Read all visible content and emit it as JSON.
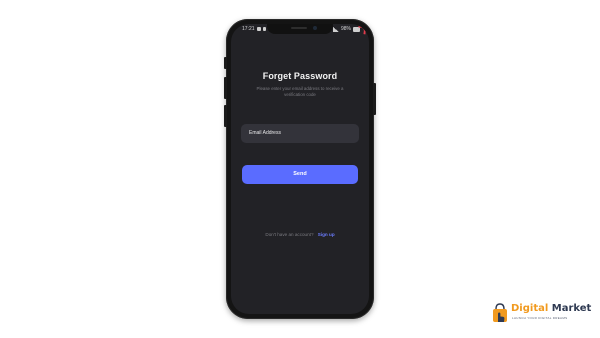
{
  "status_bar": {
    "time": "17:21",
    "battery": "98%"
  },
  "screen": {
    "title": "Forget Password",
    "subtitle": "Please enter your email address to receive a verification code",
    "email_placeholder": "Email Address",
    "send_label": "Send",
    "signup_prompt": "Don't have an account?",
    "signup_link": "Sign up"
  },
  "brand": {
    "name_part1": "Digital",
    "name_part2": "Market",
    "tagline": "LAUNCH YOUR DIGITAL DREAMS"
  },
  "colors": {
    "background": "#ffffff",
    "screen_bg": "#222226",
    "field_bg": "#33333a",
    "accent": "#5a6cff",
    "brand_orange": "#f19a1f",
    "brand_navy": "#2f3a52"
  },
  "icons": [
    "status-photo-icon",
    "status-cast-icon",
    "signal-icon",
    "battery-icon",
    "shopping-bag-icon",
    "hand-icon"
  ]
}
